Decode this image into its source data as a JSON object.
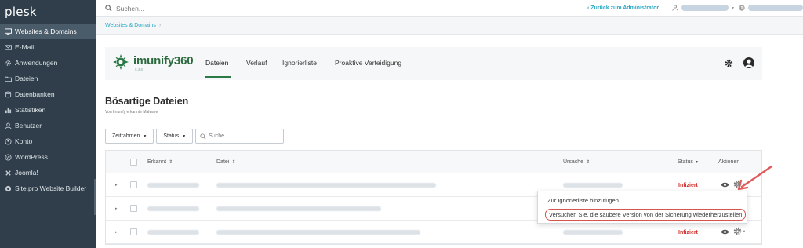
{
  "brand": {
    "logo_text": "plesk"
  },
  "sidebar": {
    "items": [
      {
        "label": "Websites & Domains",
        "icon": "monitor-icon",
        "active": true
      },
      {
        "label": "E-Mail",
        "icon": "mail-icon"
      },
      {
        "label": "Anwendungen",
        "icon": "gear-icon"
      },
      {
        "label": "Dateien",
        "icon": "folder-icon"
      },
      {
        "label": "Datenbanken",
        "icon": "database-icon"
      },
      {
        "label": "Statistiken",
        "icon": "chart-icon"
      },
      {
        "label": "Benutzer",
        "icon": "user-icon"
      },
      {
        "label": "Konto",
        "icon": "account-icon"
      },
      {
        "label": "WordPress",
        "icon": "wordpress-icon"
      },
      {
        "label": "Joomla!",
        "icon": "joomla-icon"
      },
      {
        "label": "Site.pro Website Builder",
        "icon": "sitepro-icon"
      }
    ],
    "collapse_glyph": "‹"
  },
  "topbar": {
    "search_placeholder": "Suchen...",
    "back_link": "‹ Zurück zum Administrator"
  },
  "breadcrumb": {
    "item": "Websites & Domains",
    "sep": "›"
  },
  "imunify": {
    "name": "imunify360",
    "version": "5.3.6",
    "tabs": [
      "Dateien",
      "Verlauf",
      "Ignorierliste",
      "Proaktive Verteidigung"
    ],
    "active_tab": "Dateien"
  },
  "page": {
    "title": "Bösartige Dateien",
    "subtitle": "Von Imunify erkannte Malware"
  },
  "filters": {
    "zeitrahmen": "Zeitrahmen",
    "status": "Status",
    "search_placeholder": "Suche"
  },
  "table": {
    "headers": {
      "erkannt": "Erkannt",
      "datei": "Datei",
      "ursache": "Ursache",
      "status": "Status",
      "aktionen": "Aktionen"
    },
    "sort_glyph": "⇕",
    "status_sort_glyph": "▾",
    "rows": [
      {
        "status": "Infiziert"
      },
      {
        "status": ""
      },
      {
        "status": "Infiziert"
      }
    ]
  },
  "menu": {
    "items": [
      "Zur Ignorierliste hinzufügen",
      "Versuchen Sie, die saubere Version von der Sicherung wiederherzustellen"
    ]
  },
  "colors": {
    "sidebar_bg": "#2f3e4a",
    "accent": "#28a9c4",
    "imunify_green": "#2b7a46",
    "infected_red": "#d0312d",
    "highlight_red": "#d9534f"
  }
}
